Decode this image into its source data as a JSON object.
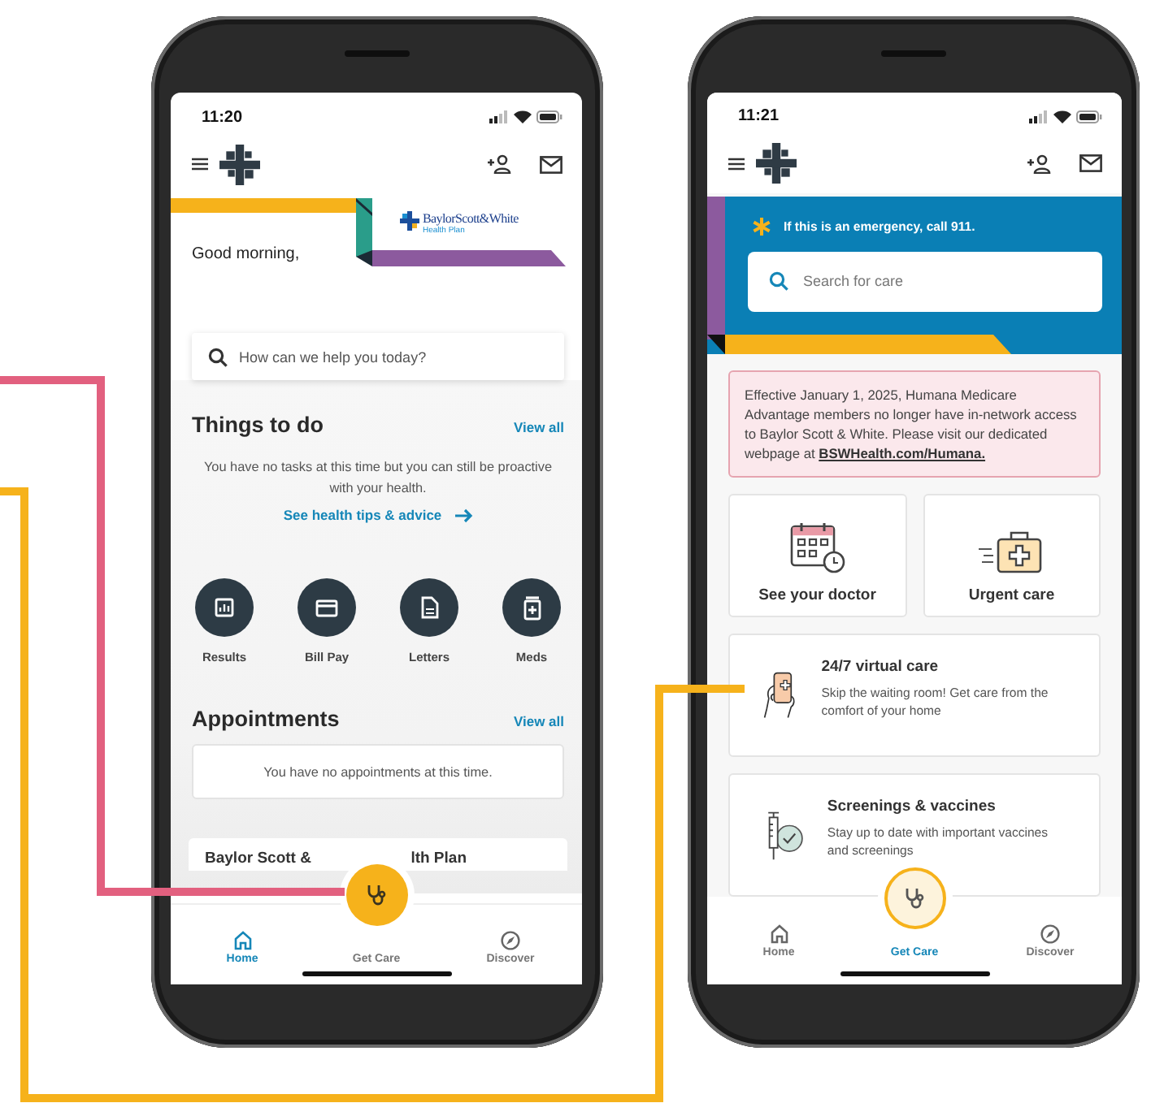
{
  "home_screen": {
    "status_bar": {
      "time": "11:20"
    },
    "brand": {
      "name": "BaylorScott&White",
      "subtitle": "Health Plan"
    },
    "greeting": "Good morning,",
    "search": {
      "placeholder": "How can we help you today?"
    },
    "things_to_do": {
      "title": "Things to do",
      "view_all": "View all",
      "message": "You have no tasks at this time but you can still be proactive with your health.",
      "link": "See health tips & advice"
    },
    "quick_actions": [
      {
        "kind": "results",
        "label": "Results"
      },
      {
        "kind": "bill",
        "label": "Bill Pay"
      },
      {
        "kind": "letters",
        "label": "Letters"
      },
      {
        "kind": "meds",
        "label": "Meds"
      }
    ],
    "appointments": {
      "title": "Appointments",
      "view_all": "View all",
      "message": "You have no appointments at this time."
    },
    "partial_card": {
      "title_start": "Baylor Scott &",
      "title_end": "lth Plan"
    },
    "nav": [
      {
        "kind": "home",
        "label": "Home",
        "selected": true
      },
      {
        "kind": "care",
        "label": "Get Care",
        "selected": false
      },
      {
        "kind": "discover",
        "label": "Discover",
        "selected": false
      }
    ]
  },
  "care_screen": {
    "status_bar": {
      "time": "11:21"
    },
    "emergency": "If this is an emergency, call 911.",
    "search": {
      "placeholder": "Search for care"
    },
    "notice": {
      "text": "Effective January 1, 2025, Humana Medicare Advantage members no longer have in-network access to Baylor Scott & White. Please visit our dedicated webpage at",
      "link": "BSWHealth.com/Humana."
    },
    "tiles": [
      {
        "kind": "doctor",
        "label": "See your doctor"
      },
      {
        "kind": "urgent",
        "label": "Urgent care"
      }
    ],
    "cards": [
      {
        "kind": "virtual",
        "title": "24/7 virtual care",
        "description": "Skip the waiting room! Get care from the comfort of your home"
      },
      {
        "kind": "screening",
        "title": "Screenings & vaccines",
        "description": "Stay up to date with important vaccines and screenings"
      }
    ],
    "nav": [
      {
        "kind": "home",
        "label": "Home",
        "selected": false
      },
      {
        "kind": "care",
        "label": "Get Care",
        "selected": true
      },
      {
        "kind": "discover",
        "label": "Discover",
        "selected": false
      }
    ]
  }
}
